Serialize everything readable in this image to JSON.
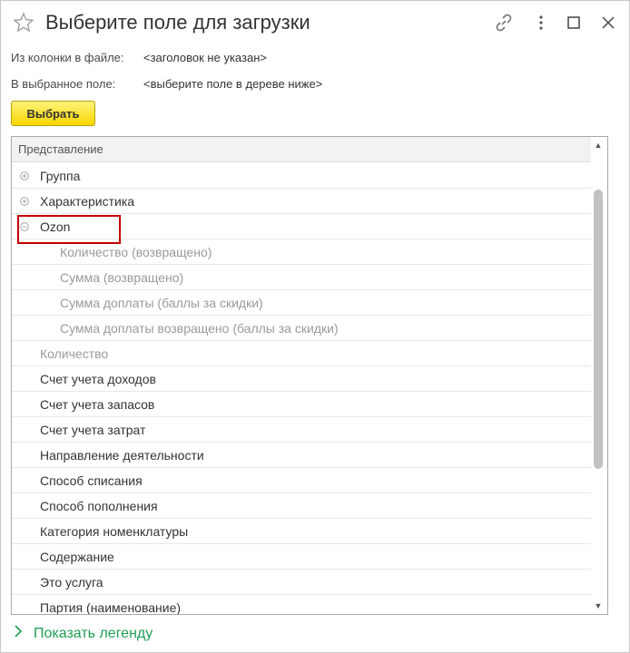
{
  "window": {
    "title": "Выберите поле для загрузки",
    "icons": [
      "star-icon",
      "link-icon",
      "more-vertical-icon",
      "maximize-icon",
      "close-icon"
    ]
  },
  "fields": {
    "source_label": "Из колонки в файле:",
    "source_value": "<заголовок не указан>",
    "target_label": "В выбранное поле:",
    "target_value": "<выберите поле в дереве ниже>"
  },
  "select_button": {
    "label": "Выбрать",
    "color": "#f7d600"
  },
  "tree": {
    "header": "Представление",
    "rows": [
      {
        "label": "Группа",
        "level": 0,
        "expander": "plus"
      },
      {
        "label": "Характеристика",
        "level": 0,
        "expander": "plus"
      },
      {
        "label": "Ozon",
        "level": 0,
        "expander": "minus",
        "highlighted": true
      },
      {
        "label": "Количество (возвращено)",
        "level": 1
      },
      {
        "label": "Сумма (возвращено)",
        "level": 1
      },
      {
        "label": "Сумма доплаты (баллы за скидки)",
        "level": 1
      },
      {
        "label": "Сумма доплаты возвращено (баллы за скидки)",
        "level": 1
      },
      {
        "label": "Количество",
        "level": 0,
        "grey": true
      },
      {
        "label": "Счет учета доходов",
        "level": 0
      },
      {
        "label": "Счет учета запасов",
        "level": 0
      },
      {
        "label": "Счет учета затрат",
        "level": 0
      },
      {
        "label": "Направление деятельности",
        "level": 0
      },
      {
        "label": "Способ списания",
        "level": 0
      },
      {
        "label": "Способ пополнения",
        "level": 0
      },
      {
        "label": "Категория номенклатуры",
        "level": 0
      },
      {
        "label": "Содержание",
        "level": 0
      },
      {
        "label": "Это услуга",
        "level": 0
      },
      {
        "label": "Партия (наименование)",
        "level": 0
      }
    ]
  },
  "legend_link": "Показать легенду",
  "colors": {
    "accent_link": "#1f9e54",
    "highlight_border": "#c00000"
  }
}
